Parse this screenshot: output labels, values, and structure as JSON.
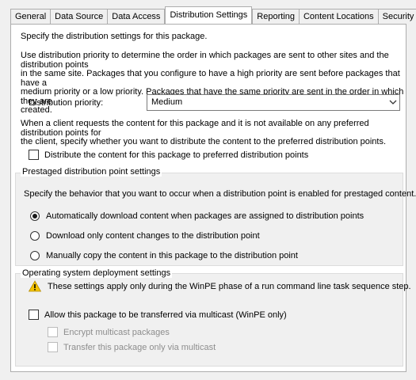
{
  "tabs": [
    {
      "label": "General",
      "active": false
    },
    {
      "label": "Data Source",
      "active": false
    },
    {
      "label": "Data Access",
      "active": false
    },
    {
      "label": "Distribution Settings",
      "active": true
    },
    {
      "label": "Reporting",
      "active": false
    },
    {
      "label": "Content Locations",
      "active": false
    },
    {
      "label": "Security",
      "active": false
    }
  ],
  "panel": {
    "intro": "Specify the distribution settings for this package.",
    "priority_help": [
      "Use distribution priority to determine the order in which packages are sent to other sites and the distribution points",
      "in the same site. Packages that you configure to have a high priority are sent before packages that have a",
      "medium priority or a low priority. Packages that have the same priority are sent in the order in which they are",
      "created."
    ],
    "priority_label": "Distribution priority:",
    "priority_value": "Medium",
    "client_help": [
      "When a client requests the content for this package and it is not available on any preferred distribution points for",
      "the client, specify whether you want to distribute the content to the preferred distribution points."
    ],
    "preferred_dp_checkbox": {
      "label": "Distribute the content for this package to preferred distribution points",
      "checked": false
    }
  },
  "prestaged": {
    "title": "Prestaged distribution point settings",
    "description": "Specify the behavior that you want to occur when a distribution point is enabled for prestaged content.",
    "options": [
      {
        "label": "Automatically download content when packages are assigned to distribution points",
        "selected": true
      },
      {
        "label": "Download only content changes to the distribution point",
        "selected": false
      },
      {
        "label": "Manually copy the content in this package to the distribution point",
        "selected": false
      }
    ]
  },
  "osd": {
    "title": "Operating system deployment settings",
    "warning": "These settings apply only during the WinPE phase of a run command line task sequence step.",
    "multicast_checkbox": {
      "label": "Allow this package to be transferred via multicast (WinPE only)",
      "checked": false
    },
    "encrypt_checkbox": {
      "label": "Encrypt multicast packages",
      "checked": false,
      "enabled": false
    },
    "multicast_only_checkbox": {
      "label": "Transfer this package only via multicast",
      "checked": false,
      "enabled": false
    }
  },
  "colors": {
    "panel_background": "#ffffff",
    "dialog_background": "#f0f0f0",
    "warning_yellow": "#f5c400",
    "disabled_text": "#8d8d8d"
  },
  "icons": {
    "dropdown": "chevron-down-icon",
    "warning": "warning-icon"
  }
}
